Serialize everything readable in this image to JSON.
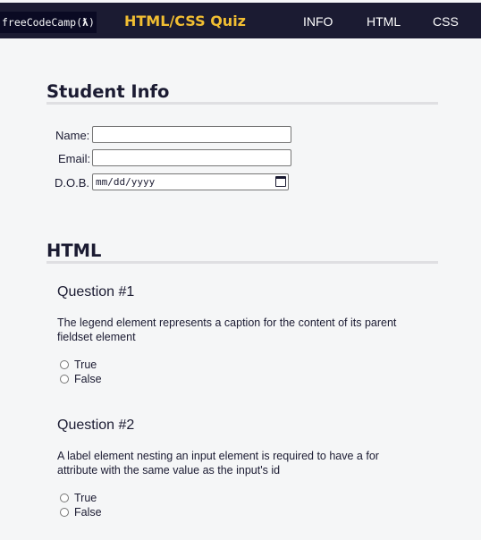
{
  "header": {
    "logo_text": "freeCodeCamp(",
    "logo_flame": "ƛ",
    "logo_end": ")",
    "title": "HTML/CSS Quiz",
    "nav": [
      {
        "label": "INFO"
      },
      {
        "label": "HTML"
      },
      {
        "label": "CSS"
      }
    ]
  },
  "student_info": {
    "heading": "Student Info",
    "name_label": "Name:",
    "name_value": "",
    "email_label": "Email:",
    "email_value": "",
    "dob_label": "D.O.B.",
    "dob_placeholder": "mm/dd/yyyy"
  },
  "html_section": {
    "heading": "HTML",
    "questions": [
      {
        "title": "Question #1",
        "text": "The legend element represents a caption for the content of its parent fieldset element",
        "options": [
          "True",
          "False"
        ]
      },
      {
        "title": "Question #2",
        "text": "A label element nesting an input element is required to have a for attribute with the same value as the input's id",
        "options": [
          "True",
          "False"
        ]
      }
    ]
  }
}
